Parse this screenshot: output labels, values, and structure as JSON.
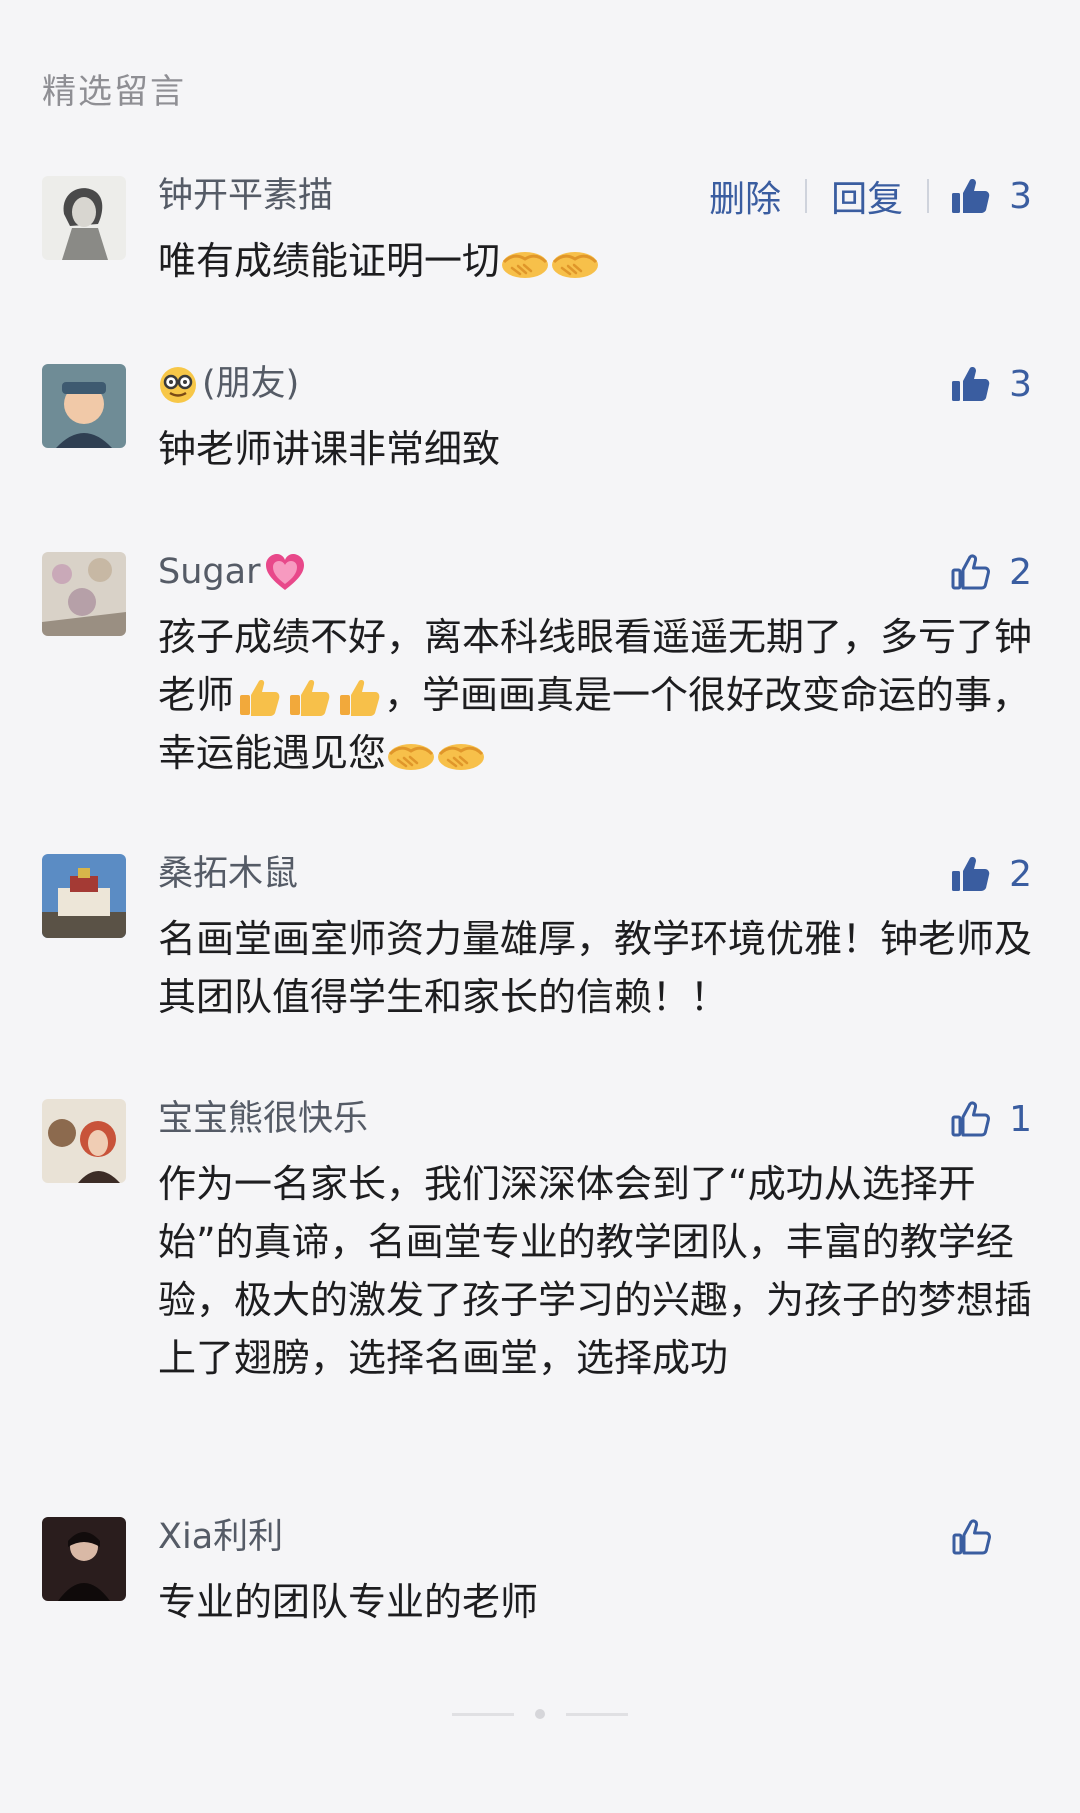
{
  "section_title": "精选留言",
  "actions": {
    "delete_label": "删除",
    "reply_label": "回复"
  },
  "comments": [
    {
      "nickname": "钟开平素描",
      "content_parts": [
        "唯有成绩能证明一切"
      ],
      "likes": "3",
      "liked": true,
      "show_delete_reply": true
    },
    {
      "nickname_suffix": "(朋友)",
      "content_parts": [
        "钟老师讲课非常细致"
      ],
      "likes": "3",
      "liked": true
    },
    {
      "nickname": "Sugar",
      "content_parts": [
        "孩子成绩不好，离本科线眼看遥遥无期了，多亏了钟老师",
        "，学画画真是一个很好改变命运的事，幸运能遇见您"
      ],
      "likes": "2",
      "liked": false
    },
    {
      "nickname": "桑拓木鼠",
      "content_parts": [
        "名画堂画室师资力量雄厚，教学环境优雅！钟老师及其团队值得学生和家长的信赖！！"
      ],
      "likes": "2",
      "liked": true
    },
    {
      "nickname": "宝宝熊很快乐",
      "content_parts": [
        "作为一名家长，我们深深体会到了“成功从选择开始”的真谛，名画堂专业的教学团队，丰富的教学经验，极大的激发了孩子学习的兴趣，为孩子的梦想插上了翅膀，选择名画堂，选择成功"
      ],
      "likes": "1",
      "liked": false
    },
    {
      "nickname": "Xia利利",
      "content_parts": [
        "专业的团队专业的老师"
      ],
      "likes": "",
      "liked": false
    }
  ],
  "colors": {
    "link": "#3a5da0",
    "nickname": "#555b66",
    "background": "#f5f5f7"
  },
  "icons": [
    "thumb-up-icon",
    "handshake-emoji",
    "thumbs-up-emoji",
    "nerd-face-emoji",
    "heart-emoji"
  ]
}
